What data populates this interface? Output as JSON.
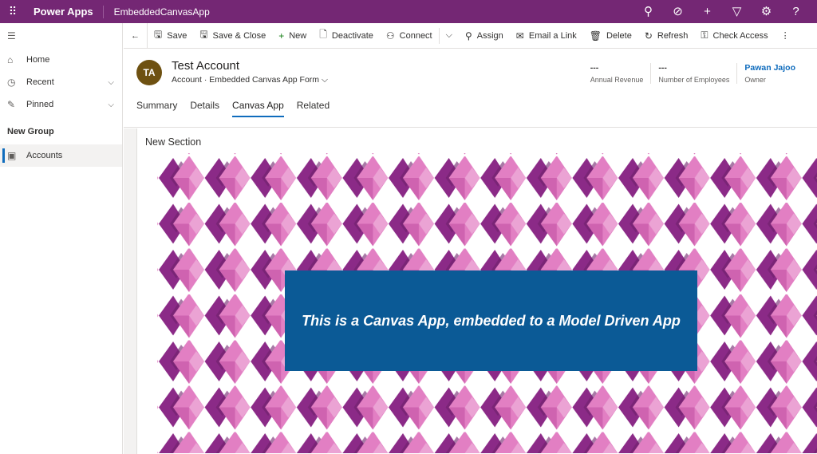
{
  "topbar": {
    "brand": "Power Apps",
    "app_name": "EmbeddedCanvasApp"
  },
  "sidebar": {
    "items": [
      {
        "label": "Home"
      },
      {
        "label": "Recent"
      },
      {
        "label": "Pinned"
      }
    ],
    "group": "New Group",
    "group_items": [
      {
        "label": "Accounts"
      }
    ]
  },
  "commands": [
    "Save",
    "Save & Close",
    "New",
    "Deactivate",
    "Connect",
    "Assign",
    "Email a Link",
    "Delete",
    "Refresh",
    "Check Access"
  ],
  "record": {
    "initials": "TA",
    "title": "Test Account",
    "entity": "Account",
    "form": "Embedded Canvas App Form"
  },
  "kpis": [
    {
      "value": "---",
      "label": "Annual Revenue"
    },
    {
      "value": "---",
      "label": "Number of Employees"
    },
    {
      "value": "Pawan Jajoo",
      "label": "Owner"
    }
  ],
  "tabs": [
    "Summary",
    "Details",
    "Canvas App",
    "Related"
  ],
  "section": {
    "title": "New Section",
    "banner": "This is a Canvas App, embedded to a Model Driven App"
  },
  "colors": {
    "header": "#742774",
    "banner": "#0b5a96",
    "diamond_dark": "#8b2a87",
    "diamond_light": "#e486c6"
  }
}
